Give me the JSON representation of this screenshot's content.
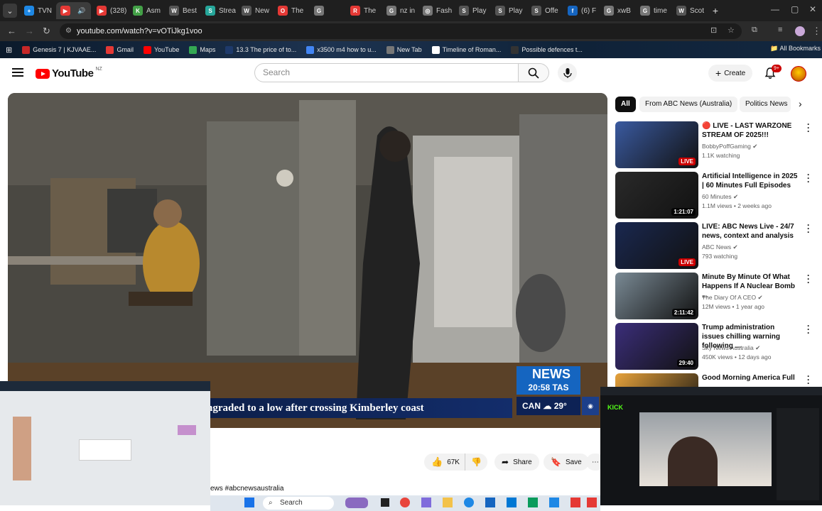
{
  "browser": {
    "tabs": [
      {
        "label": "TVN",
        "color": "#1e88e5",
        "glyph": "+"
      },
      {
        "label": "",
        "color": "#e53935",
        "glyph": "▶",
        "active": true
      },
      {
        "label": "(328)",
        "color": "#e53935",
        "glyph": "▶"
      },
      {
        "label": "Asm",
        "color": "#43a047",
        "glyph": "K"
      },
      {
        "label": "Best",
        "color": "#555555",
        "glyph": "W"
      },
      {
        "label": "Strea",
        "color": "#26a69a",
        "glyph": "S"
      },
      {
        "label": "New",
        "color": "#555555",
        "glyph": "W"
      },
      {
        "label": "The",
        "color": "#e53935",
        "glyph": "O"
      },
      {
        "label": "",
        "color": "#777777",
        "glyph": "G"
      },
      {
        "label": "The",
        "color": "#e53935",
        "glyph": "R"
      },
      {
        "label": "nz in",
        "color": "#777777",
        "glyph": "G"
      },
      {
        "label": "Fash",
        "color": "#777777",
        "glyph": "◎"
      },
      {
        "label": "Play",
        "color": "#555555",
        "glyph": "S"
      },
      {
        "label": "Play",
        "color": "#555555",
        "glyph": "S"
      },
      {
        "label": "Offe",
        "color": "#555555",
        "glyph": "S"
      },
      {
        "label": "(6) F",
        "color": "#1565c0",
        "glyph": "f"
      },
      {
        "label": "xwB",
        "color": "#777777",
        "glyph": "G"
      },
      {
        "label": "time",
        "color": "#777777",
        "glyph": "G"
      },
      {
        "label": "Scot",
        "color": "#555555",
        "glyph": "W"
      }
    ],
    "url": "youtube.com/watch?v=vOTiJkg1voo",
    "bookmarks": [
      {
        "label": "Genesis 7 | KJVAAE...",
        "color": "#c62828"
      },
      {
        "label": "Gmail",
        "color": "#e53935"
      },
      {
        "label": "YouTube",
        "color": "#ff0000"
      },
      {
        "label": "Maps",
        "color": "#34a853"
      },
      {
        "label": "13.3 The price of to...",
        "color": "#1e3a6b"
      },
      {
        "label": "x3500 m4 how to u...",
        "color": "#4285f4"
      },
      {
        "label": "New Tab",
        "color": "#777777"
      },
      {
        "label": "Timeline of Roman...",
        "color": "#ffffff"
      },
      {
        "label": "Possible defences t...",
        "color": "#333333"
      }
    ],
    "all_bookmarks": "All Bookmarks"
  },
  "youtube": {
    "logo_text": "YouTube",
    "country": "NZ",
    "search_placeholder": "Search",
    "create_label": "Create",
    "notification_badge": "9+",
    "chips": [
      "All",
      "From ABC News (Australia)",
      "Politics News"
    ],
    "video": {
      "ticker": "ngraded to a low after crossing Kimberley coast",
      "brand": "NEWS",
      "time": "20:58 TAS",
      "weather_city": "CAN",
      "weather_temp": "29°"
    },
    "actions": {
      "likes": "67K",
      "share": "Share",
      "save": "Save"
    },
    "hashtag": "ews #abcnewsaustralia",
    "recommendations": [
      {
        "title": "🔴 LIVE - LAST WARZONE STREAM OF 2025!!!",
        "channel": "BobbyPoffGaming",
        "meta": "1.1K watching",
        "badge": "LIVE",
        "thumb": "#3a5aa0"
      },
      {
        "title": "Artificial Intelligence in 2025 | 60 Minutes Full Episodes",
        "channel": "60 Minutes",
        "meta": "1.1M views • 2 weeks ago",
        "badge": "1:21:07",
        "thumb": "#2a2a2a"
      },
      {
        "title": "LIVE: ABC News Live - 24/7 news, context and analysis",
        "channel": "ABC News",
        "meta": "793 watching",
        "badge": "LIVE",
        "thumb": "#1a2850"
      },
      {
        "title": "Minute By Minute Of What Happens If A Nuclear Bomb ...",
        "channel": "The Diary Of A CEO",
        "meta": "12M views • 1 year ago",
        "badge": "2:11:42",
        "thumb": "#7a8a95"
      },
      {
        "title": "Trump administration issues chilling warning following ...",
        "channel": "Sky News Australia",
        "meta": "450K views • 12 days ago",
        "badge": "29:40",
        "thumb": "#3b2e7a"
      },
      {
        "title": "Good Morning America Full",
        "channel": "",
        "meta": "",
        "badge": "",
        "thumb": "#e6a23c"
      }
    ]
  },
  "taskbar": {
    "search": "Search"
  }
}
